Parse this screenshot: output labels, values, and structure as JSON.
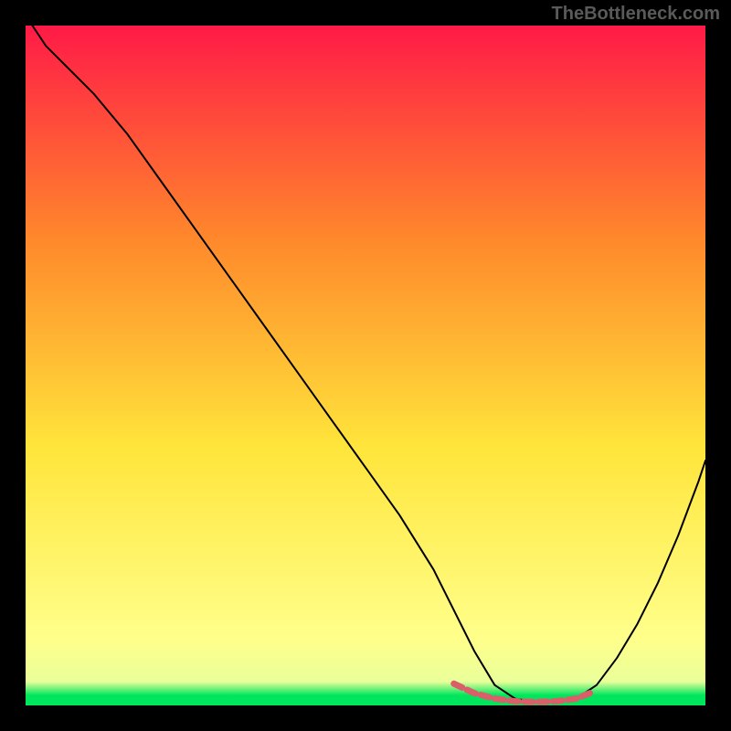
{
  "watermark": "TheBottleneck.com",
  "chart_data": {
    "type": "line",
    "title": "",
    "xlabel": "",
    "ylabel": "",
    "xlim": [
      0,
      100
    ],
    "ylim": [
      0,
      100
    ],
    "background_gradient": {
      "top": "#ff1a47",
      "mid_upper": "#ff8a2b",
      "mid_lower": "#ffe53b",
      "near_bottom": "#ffff8a",
      "bottom": "#00e65c"
    },
    "series": [
      {
        "name": "bottleneck-curve",
        "color": "#000000",
        "stroke_width": 2,
        "x": [
          1,
          3,
          6,
          10,
          15,
          20,
          25,
          30,
          35,
          40,
          45,
          50,
          55,
          60,
          63,
          66,
          69,
          72,
          75,
          78,
          81,
          84,
          87,
          90,
          93,
          96,
          99,
          100
        ],
        "y": [
          100,
          97,
          94,
          90,
          84,
          77,
          70,
          63,
          56,
          49,
          42,
          35,
          28,
          20,
          14,
          8,
          3,
          1,
          0.5,
          0.5,
          1,
          3,
          7,
          12,
          18,
          25,
          33,
          36
        ]
      },
      {
        "name": "optimal-zone-marker",
        "color": "#d9606a",
        "stroke_width": 7,
        "dash": "10 6",
        "x": [
          63,
          66,
          69,
          72,
          75,
          78,
          81,
          83
        ],
        "y": [
          3.2,
          1.8,
          1.0,
          0.6,
          0.5,
          0.6,
          1.0,
          1.8
        ]
      }
    ]
  }
}
